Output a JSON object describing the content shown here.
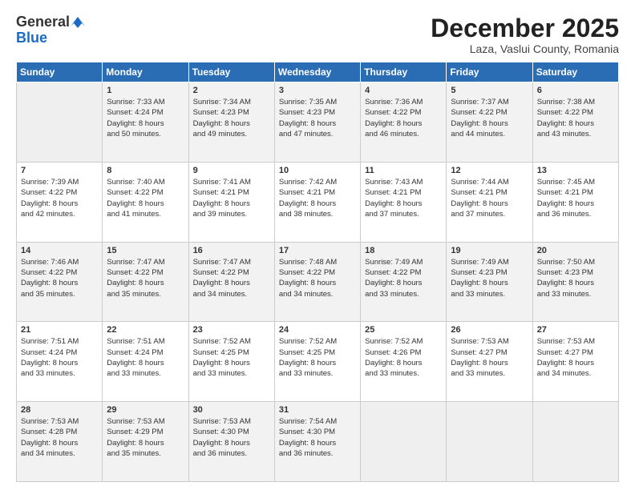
{
  "header": {
    "logo_general": "General",
    "logo_blue": "Blue",
    "month_title": "December 2025",
    "location": "Laza, Vaslui County, Romania"
  },
  "calendar": {
    "days_of_week": [
      "Sunday",
      "Monday",
      "Tuesday",
      "Wednesday",
      "Thursday",
      "Friday",
      "Saturday"
    ],
    "weeks": [
      [
        {
          "day": "",
          "info": ""
        },
        {
          "day": "1",
          "info": "Sunrise: 7:33 AM\nSunset: 4:24 PM\nDaylight: 8 hours\nand 50 minutes."
        },
        {
          "day": "2",
          "info": "Sunrise: 7:34 AM\nSunset: 4:23 PM\nDaylight: 8 hours\nand 49 minutes."
        },
        {
          "day": "3",
          "info": "Sunrise: 7:35 AM\nSunset: 4:23 PM\nDaylight: 8 hours\nand 47 minutes."
        },
        {
          "day": "4",
          "info": "Sunrise: 7:36 AM\nSunset: 4:22 PM\nDaylight: 8 hours\nand 46 minutes."
        },
        {
          "day": "5",
          "info": "Sunrise: 7:37 AM\nSunset: 4:22 PM\nDaylight: 8 hours\nand 44 minutes."
        },
        {
          "day": "6",
          "info": "Sunrise: 7:38 AM\nSunset: 4:22 PM\nDaylight: 8 hours\nand 43 minutes."
        }
      ],
      [
        {
          "day": "7",
          "info": "Sunrise: 7:39 AM\nSunset: 4:22 PM\nDaylight: 8 hours\nand 42 minutes."
        },
        {
          "day": "8",
          "info": "Sunrise: 7:40 AM\nSunset: 4:22 PM\nDaylight: 8 hours\nand 41 minutes."
        },
        {
          "day": "9",
          "info": "Sunrise: 7:41 AM\nSunset: 4:21 PM\nDaylight: 8 hours\nand 39 minutes."
        },
        {
          "day": "10",
          "info": "Sunrise: 7:42 AM\nSunset: 4:21 PM\nDaylight: 8 hours\nand 38 minutes."
        },
        {
          "day": "11",
          "info": "Sunrise: 7:43 AM\nSunset: 4:21 PM\nDaylight: 8 hours\nand 37 minutes."
        },
        {
          "day": "12",
          "info": "Sunrise: 7:44 AM\nSunset: 4:21 PM\nDaylight: 8 hours\nand 37 minutes."
        },
        {
          "day": "13",
          "info": "Sunrise: 7:45 AM\nSunset: 4:21 PM\nDaylight: 8 hours\nand 36 minutes."
        }
      ],
      [
        {
          "day": "14",
          "info": "Sunrise: 7:46 AM\nSunset: 4:22 PM\nDaylight: 8 hours\nand 35 minutes."
        },
        {
          "day": "15",
          "info": "Sunrise: 7:47 AM\nSunset: 4:22 PM\nDaylight: 8 hours\nand 35 minutes."
        },
        {
          "day": "16",
          "info": "Sunrise: 7:47 AM\nSunset: 4:22 PM\nDaylight: 8 hours\nand 34 minutes."
        },
        {
          "day": "17",
          "info": "Sunrise: 7:48 AM\nSunset: 4:22 PM\nDaylight: 8 hours\nand 34 minutes."
        },
        {
          "day": "18",
          "info": "Sunrise: 7:49 AM\nSunset: 4:22 PM\nDaylight: 8 hours\nand 33 minutes."
        },
        {
          "day": "19",
          "info": "Sunrise: 7:49 AM\nSunset: 4:23 PM\nDaylight: 8 hours\nand 33 minutes."
        },
        {
          "day": "20",
          "info": "Sunrise: 7:50 AM\nSunset: 4:23 PM\nDaylight: 8 hours\nand 33 minutes."
        }
      ],
      [
        {
          "day": "21",
          "info": "Sunrise: 7:51 AM\nSunset: 4:24 PM\nDaylight: 8 hours\nand 33 minutes."
        },
        {
          "day": "22",
          "info": "Sunrise: 7:51 AM\nSunset: 4:24 PM\nDaylight: 8 hours\nand 33 minutes."
        },
        {
          "day": "23",
          "info": "Sunrise: 7:52 AM\nSunset: 4:25 PM\nDaylight: 8 hours\nand 33 minutes."
        },
        {
          "day": "24",
          "info": "Sunrise: 7:52 AM\nSunset: 4:25 PM\nDaylight: 8 hours\nand 33 minutes."
        },
        {
          "day": "25",
          "info": "Sunrise: 7:52 AM\nSunset: 4:26 PM\nDaylight: 8 hours\nand 33 minutes."
        },
        {
          "day": "26",
          "info": "Sunrise: 7:53 AM\nSunset: 4:27 PM\nDaylight: 8 hours\nand 33 minutes."
        },
        {
          "day": "27",
          "info": "Sunrise: 7:53 AM\nSunset: 4:27 PM\nDaylight: 8 hours\nand 34 minutes."
        }
      ],
      [
        {
          "day": "28",
          "info": "Sunrise: 7:53 AM\nSunset: 4:28 PM\nDaylight: 8 hours\nand 34 minutes."
        },
        {
          "day": "29",
          "info": "Sunrise: 7:53 AM\nSunset: 4:29 PM\nDaylight: 8 hours\nand 35 minutes."
        },
        {
          "day": "30",
          "info": "Sunrise: 7:53 AM\nSunset: 4:30 PM\nDaylight: 8 hours\nand 36 minutes."
        },
        {
          "day": "31",
          "info": "Sunrise: 7:54 AM\nSunset: 4:30 PM\nDaylight: 8 hours\nand 36 minutes."
        },
        {
          "day": "",
          "info": ""
        },
        {
          "day": "",
          "info": ""
        },
        {
          "day": "",
          "info": ""
        }
      ]
    ]
  }
}
